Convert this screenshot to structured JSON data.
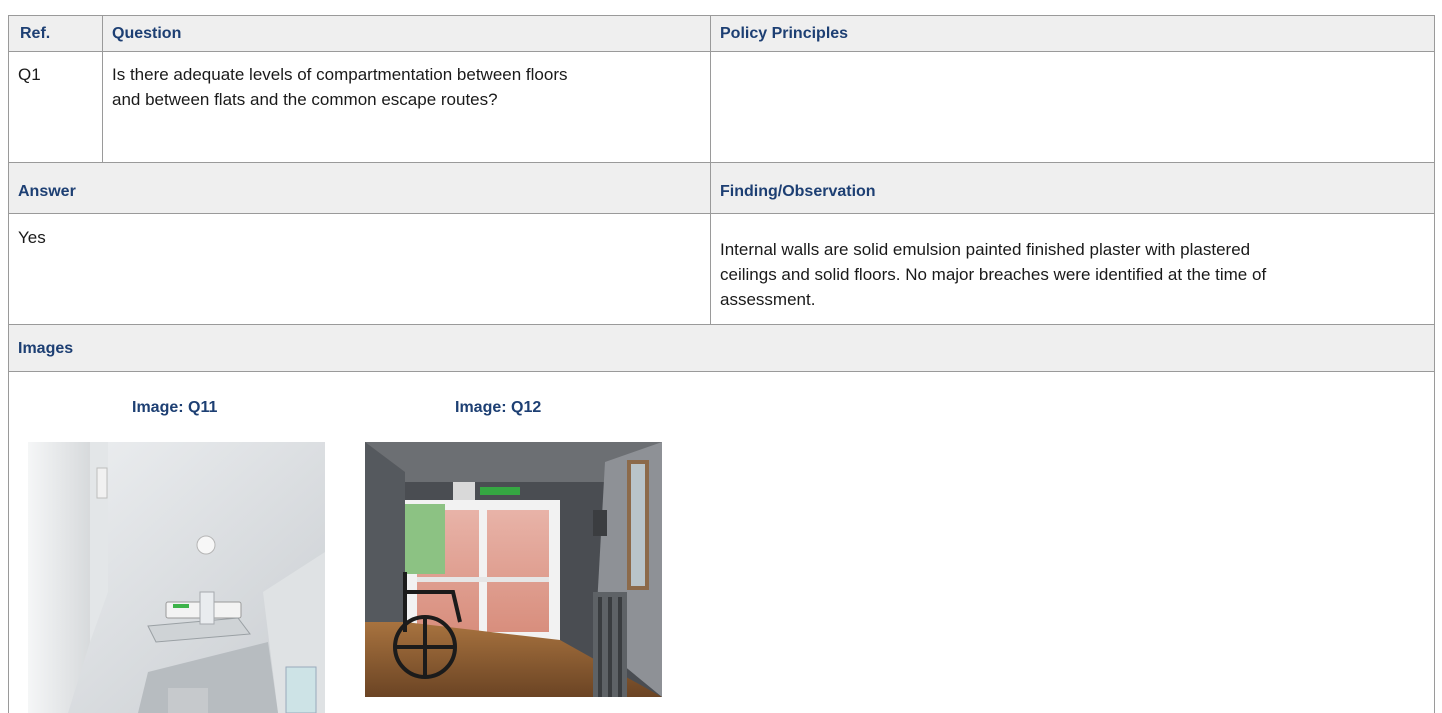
{
  "table": {
    "headers": {
      "ref": "Ref.",
      "question": "Question",
      "policy": "Policy Principles"
    },
    "row": {
      "ref": "Q1",
      "question": "Is there adequate levels of compartmentation between floors and between flats and the common escape routes?",
      "policy": ""
    },
    "answer_header": "Answer",
    "finding_header": "Finding/Observation",
    "answer": "Yes",
    "finding": "Internal walls are solid emulsion painted finished plaster with plastered ceilings and solid floors. No major breaches were identified at the time of assessment.",
    "images_header": "Images"
  },
  "images": [
    {
      "caption": "Image: Q11",
      "subject": "ceiling corridor with smoke detector and light fitting"
    },
    {
      "caption": "Image: Q12",
      "subject": "corridor with exit door, wheelchair and radiator"
    }
  ],
  "colors": {
    "header_bg": "#efefef",
    "header_text": "#1d3f73",
    "border": "#9a9a9a"
  }
}
